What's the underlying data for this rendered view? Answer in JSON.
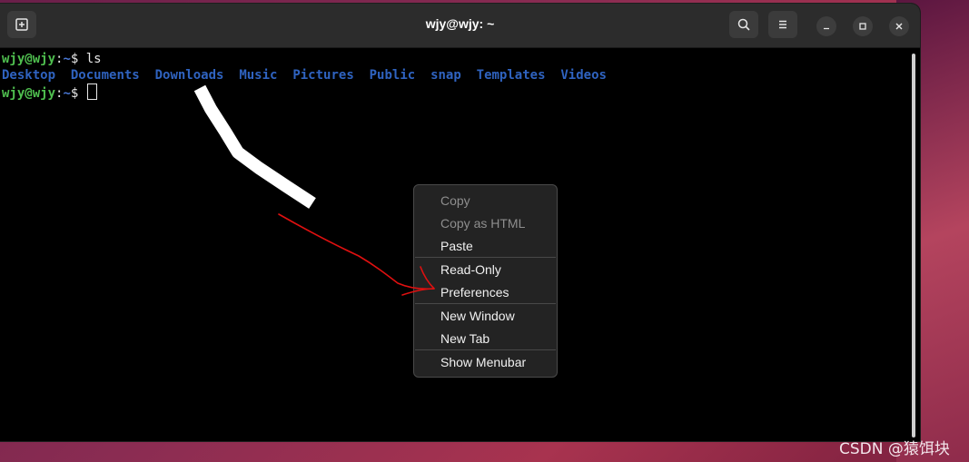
{
  "window": {
    "title": "wjy@wjy: ~",
    "buttons": {
      "new_tab_icon": "new-tab-icon",
      "search_icon": "search-icon",
      "menu_icon": "hamburger-menu-icon",
      "minimize": "–",
      "maximize": "□",
      "close": "✕"
    }
  },
  "terminal": {
    "line1": {
      "user": "wjy@wjy",
      "sep": ":",
      "path": "~",
      "prompt": "$ ",
      "command": "ls"
    },
    "directories": [
      "Desktop",
      "Documents",
      "Downloads",
      "Music",
      "Pictures",
      "Public",
      "snap",
      "Templates",
      "Videos"
    ],
    "line3": {
      "user": "wjy@wjy",
      "sep": ":",
      "path": "~",
      "prompt": "$ "
    }
  },
  "context_menu": {
    "items": [
      {
        "label": "Copy",
        "enabled": false
      },
      {
        "label": "Copy as HTML",
        "enabled": false
      },
      {
        "label": "Paste",
        "enabled": true
      },
      {
        "label": "Read-Only",
        "enabled": true
      },
      {
        "label": "Preferences",
        "enabled": true
      },
      {
        "label": "New Window",
        "enabled": true
      },
      {
        "label": "New Tab",
        "enabled": true
      },
      {
        "label": "Show Menubar",
        "enabled": true
      }
    ]
  },
  "watermark": "CSDN @猿饵块",
  "colors": {
    "prompt_user": "#4fbf4f",
    "prompt_path": "#4a78d6",
    "directory": "#2f63c0",
    "annotation_arrow": "#e01010",
    "annotation_stroke": "#ffffff"
  }
}
